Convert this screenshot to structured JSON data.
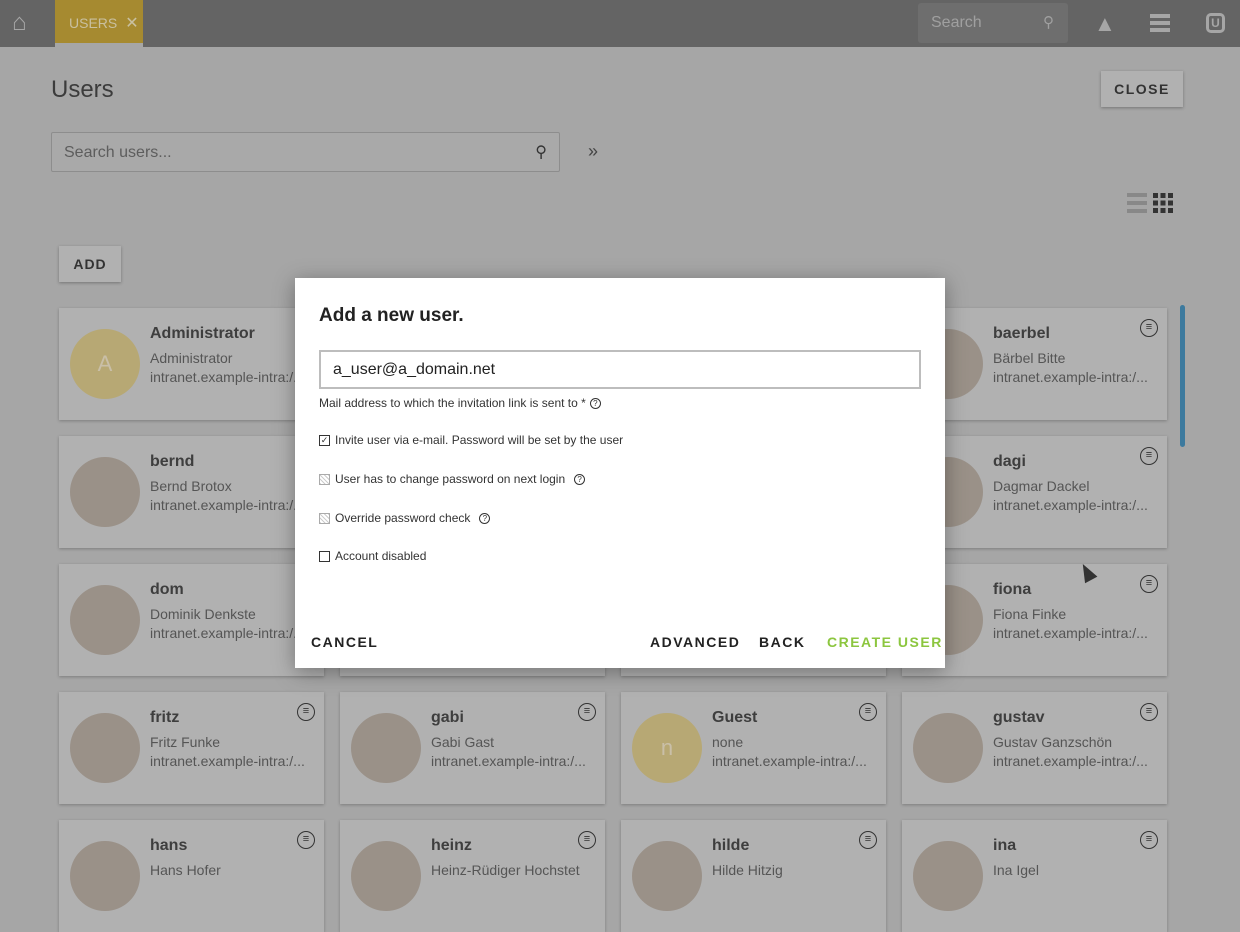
{
  "topbar": {
    "home_icon": "home-icon",
    "tab_label": "USERS",
    "tab_close": "✕",
    "search_placeholder": "Search",
    "icons": [
      "bell-icon",
      "menu-icon",
      "user-menu-icon"
    ],
    "tab_color": "#a68a30"
  },
  "page": {
    "title": "Users",
    "close_label": "CLOSE",
    "search_placeholder": "Search users...",
    "expand_label": "»",
    "add_label": "ADD"
  },
  "cards": [
    {
      "name": "Administrator",
      "full": "Administrator",
      "url": "intranet.example-intra:/...",
      "letter": "A"
    },
    {},
    {},
    {
      "name": "baerbel",
      "full": "Bärbel Bitte",
      "url": "intranet.example-intra:/..."
    },
    {
      "name": "bernd",
      "full": "Bernd Brotox",
      "url": "intranet.example-intra:/..."
    },
    {},
    {},
    {
      "name": "dagi",
      "full": "Dagmar Dackel",
      "url": "intranet.example-intra:/..."
    },
    {
      "name": "dom",
      "full": "Dominik Denkste",
      "url": "intranet.example-intra:/..."
    },
    {},
    {},
    {
      "name": "fiona",
      "full": "Fiona Finke",
      "url": "intranet.example-intra:/..."
    },
    {
      "name": "fritz",
      "full": "Fritz Funke",
      "url": "intranet.example-intra:/..."
    },
    {
      "name": "gabi",
      "full": "Gabi Gast",
      "url": "intranet.example-intra:/..."
    },
    {
      "name": "Guest",
      "full": "none",
      "url": "intranet.example-intra:/...",
      "letter": "n"
    },
    {
      "name": "gustav",
      "full": "Gustav Ganzschön",
      "url": "intranet.example-intra:/..."
    },
    {
      "name": "hans",
      "full": "Hans Hofer",
      "url": ""
    },
    {
      "name": "heinz",
      "full": "Heinz-Rüdiger Hochstet",
      "url": ""
    },
    {
      "name": "hilde",
      "full": "Hilde Hitzig",
      "url": ""
    },
    {
      "name": "ina",
      "full": "Ina Igel",
      "url": ""
    }
  ],
  "dialog": {
    "title": "Add a new user.",
    "email_value": "a_user@a_domain.net",
    "email_hint": "Mail address to which the invitation link is sent to *",
    "options": [
      {
        "label": "Invite user via e-mail. Password will be set by the user",
        "state": "checked",
        "help": false
      },
      {
        "label": "User has to change password on next login",
        "state": "disabled-checked",
        "help": true
      },
      {
        "label": "Override password check",
        "state": "disabled-checked",
        "help": true
      },
      {
        "label": "Account disabled",
        "state": "unchecked",
        "help": false
      }
    ],
    "cancel": "CANCEL",
    "advanced": "ADVANCED",
    "back": "BACK",
    "create": "CREATE USER",
    "create_color": "#8cc63f"
  }
}
